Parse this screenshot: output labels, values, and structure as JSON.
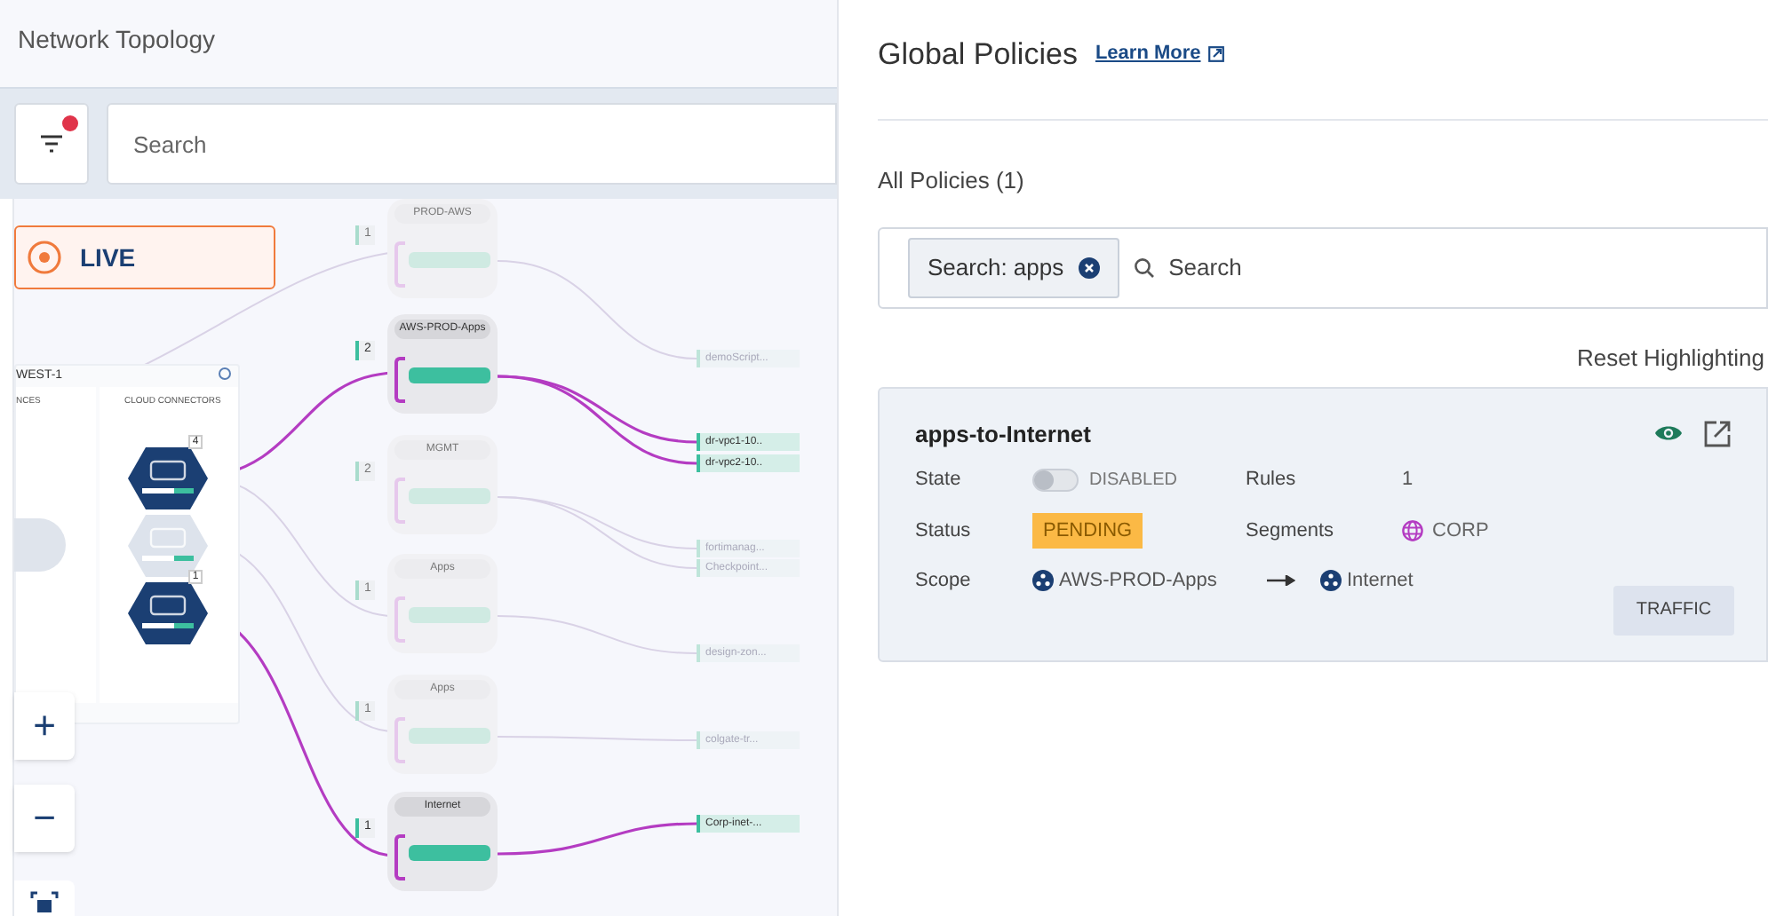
{
  "topology": {
    "title": "Network Topology",
    "search": {
      "placeholder": "Search"
    },
    "filter_active": true,
    "live_button": "LIVE",
    "region": {
      "name": "WEST-1",
      "columns": [
        "NCES",
        "CLOUD CONNECTORS"
      ],
      "connectors": [
        {
          "badge": "4",
          "highlighted": true
        },
        {
          "highlighted": false
        },
        {
          "badge": "1",
          "highlighted": true
        }
      ]
    },
    "segments": [
      {
        "name": "PROD-AWS",
        "count": "1",
        "highlighted": false,
        "targets": [
          {
            "name": "demoScript...",
            "highlighted": false
          }
        ]
      },
      {
        "name": "AWS-PROD-Apps",
        "count": "2",
        "highlighted": true,
        "targets": [
          {
            "name": "dr-vpc1-10..",
            "highlighted": true
          },
          {
            "name": "dr-vpc2-10..",
            "highlighted": true
          }
        ]
      },
      {
        "name": "MGMT",
        "count": "2",
        "highlighted": false,
        "targets": [
          {
            "name": "fortimanag...",
            "highlighted": false
          },
          {
            "name": "Checkpoint...",
            "highlighted": false
          }
        ]
      },
      {
        "name": "Apps",
        "count": "1",
        "highlighted": false,
        "targets": [
          {
            "name": "design-zon...",
            "highlighted": false
          }
        ]
      },
      {
        "name": "Apps",
        "count": "1",
        "highlighted": false,
        "targets": [
          {
            "name": "colgate-tr...",
            "highlighted": false
          }
        ]
      },
      {
        "name": "Internet",
        "count": "1",
        "highlighted": true,
        "targets": [
          {
            "name": "Corp-inet-...",
            "highlighted": true
          }
        ]
      }
    ],
    "zoom_controls": [
      "+",
      "−"
    ]
  },
  "policies": {
    "title": "Global Policies",
    "learn_more": "Learn More",
    "list_title": "All Policies (1)",
    "search": {
      "chip": "Search: apps",
      "placeholder": "Search"
    },
    "reset": "Reset Highlighting",
    "cards": [
      {
        "name": "apps-to-Internet",
        "visible": true,
        "state_label": "State",
        "enabled": false,
        "state_text": "DISABLED",
        "rules_label": "Rules",
        "rules": "1",
        "status_label": "Status",
        "status": "PENDING",
        "segments_label": "Segments",
        "segment": "CORP",
        "scope_label": "Scope",
        "scope_from": "AWS-PROD-Apps",
        "scope_to": "Internet",
        "traffic_button": "TRAFFIC"
      }
    ]
  }
}
